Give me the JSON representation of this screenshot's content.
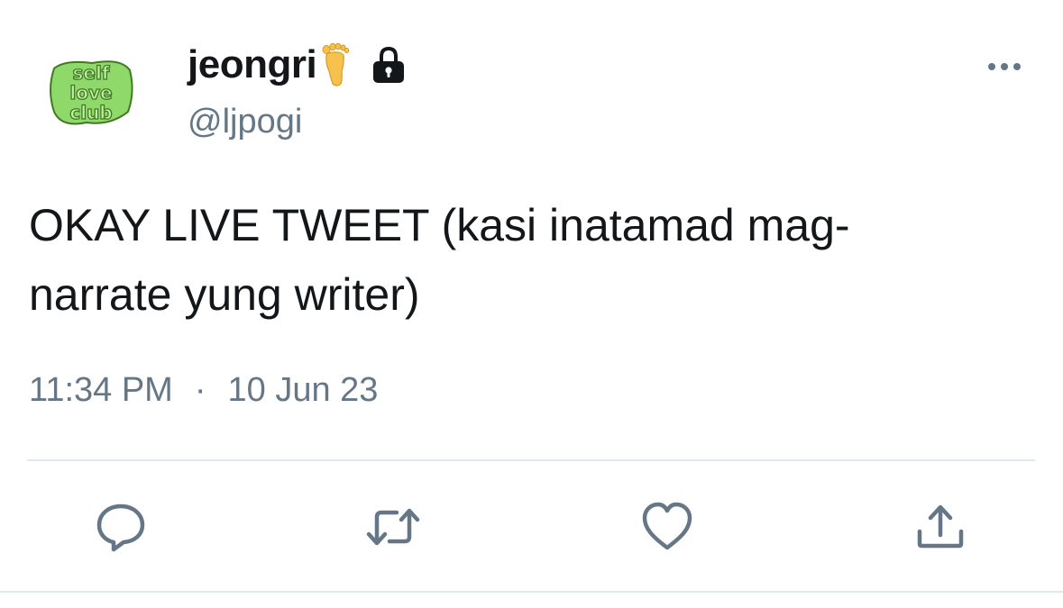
{
  "tweet": {
    "display_name": "jeongri",
    "name_emoji": "foot-emoji",
    "protected_icon": "lock-icon",
    "handle": "@ljpogi",
    "avatar_text": [
      "self",
      "love",
      "club"
    ],
    "text_line1": "OKAY LIVE TWEET (kasi inatamad mag-",
    "text_line2": "narrate yung writer)",
    "time": "11:34 PM",
    "separator": "·",
    "date": "10 Jun 23"
  },
  "actions": [
    {
      "name": "reply",
      "icon": "reply-icon"
    },
    {
      "name": "retweet",
      "icon": "retweet-icon"
    },
    {
      "name": "like",
      "icon": "heart-icon"
    },
    {
      "name": "share",
      "icon": "share-icon"
    }
  ],
  "colors": {
    "text": "#14171a",
    "secondary": "#657786",
    "icon": "#657786",
    "divider": "#e1e8ed",
    "avatar_green": "#8fd86a",
    "avatar_dark": "#3f7a23"
  }
}
